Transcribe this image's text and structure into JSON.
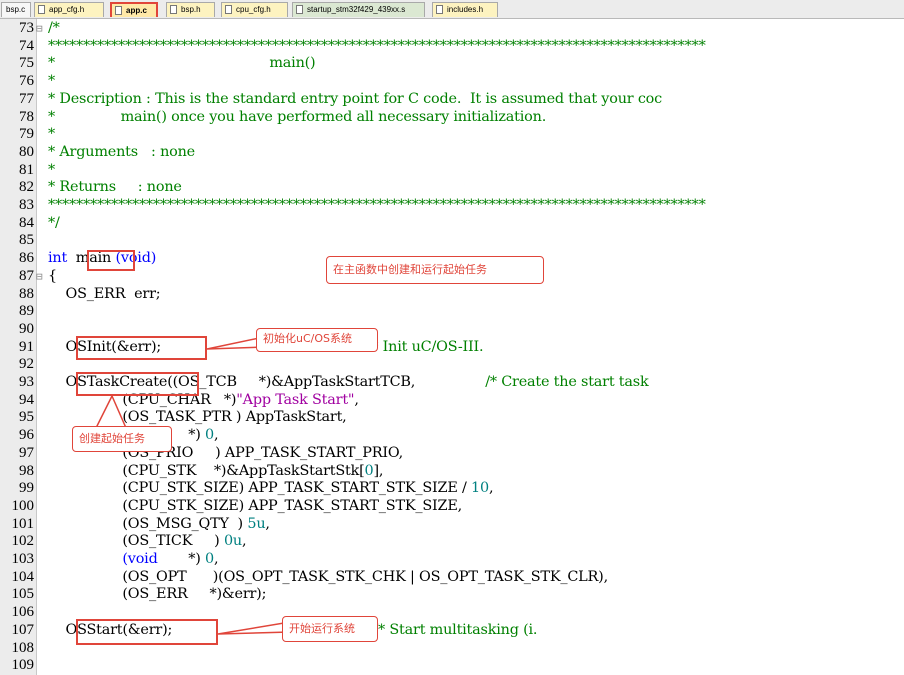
{
  "tabs": [
    {
      "label": "bsp.c",
      "kind": "c",
      "icon": "c-file-icon"
    },
    {
      "label": "app_cfg.h",
      "kind": "h",
      "icon": "h-file-icon"
    },
    {
      "label": "app.c",
      "kind": "c",
      "icon": "c-file-icon",
      "active": true
    },
    {
      "label": "bsp.h",
      "kind": "h",
      "icon": "h-file-icon"
    },
    {
      "label": "cpu_cfg.h",
      "kind": "h",
      "icon": "h-file-icon"
    },
    {
      "label": "startup_stm32f429_439xx.s",
      "kind": "s",
      "icon": "asm-file-icon"
    },
    {
      "label": "includes.h",
      "kind": "h",
      "icon": "h-file-icon"
    }
  ],
  "lines": [
    {
      "n": "73",
      "fold": "⊟",
      "parts": [
        [
          "cm",
          "/*"
        ]
      ]
    },
    {
      "n": "74",
      "parts": [
        [
          "cm",
          "**********************************************************************************************"
        ]
      ]
    },
    {
      "n": "75",
      "parts": [
        [
          "cm",
          "*                                                 main()"
        ]
      ]
    },
    {
      "n": "76",
      "parts": [
        [
          "cm",
          "*"
        ]
      ]
    },
    {
      "n": "77",
      "parts": [
        [
          "cm",
          "* Description : This is the standard entry point for C code.  It is assumed that your coc"
        ]
      ]
    },
    {
      "n": "78",
      "parts": [
        [
          "cm",
          "*               main() once you have performed all necessary initialization."
        ]
      ]
    },
    {
      "n": "79",
      "parts": [
        [
          "cm",
          "*"
        ]
      ]
    },
    {
      "n": "80",
      "parts": [
        [
          "cm",
          "* Arguments   : none"
        ]
      ]
    },
    {
      "n": "81",
      "parts": [
        [
          "cm",
          "*"
        ]
      ]
    },
    {
      "n": "82",
      "parts": [
        [
          "cm",
          "* Returns     : none"
        ]
      ]
    },
    {
      "n": "83",
      "parts": [
        [
          "cm",
          "**********************************************************************************************"
        ]
      ]
    },
    {
      "n": "84",
      "parts": [
        [
          "cm",
          "*/"
        ]
      ]
    },
    {
      "n": "85",
      "parts": []
    },
    {
      "n": "86",
      "parts": [
        [
          "kw",
          "int"
        ],
        [
          "",
          "  main "
        ],
        [
          "kw",
          "(void)"
        ]
      ]
    },
    {
      "n": "87",
      "fold": "⊟",
      "parts": [
        [
          "",
          "{"
        ]
      ]
    },
    {
      "n": "88",
      "parts": [
        [
          "",
          "    OS_ERR  err;"
        ]
      ]
    },
    {
      "n": "89",
      "parts": []
    },
    {
      "n": "90",
      "parts": []
    },
    {
      "n": "91",
      "parts": [
        [
          "",
          "    OSInit(&err);                                               "
        ],
        [
          "cm",
          "/* Init uC/OS-III."
        ]
      ]
    },
    {
      "n": "92",
      "parts": []
    },
    {
      "n": "93",
      "parts": [
        [
          "",
          "    OSTaskCreate((OS_TCB     *)&AppTaskStartTCB,                "
        ],
        [
          "cm",
          "/* Create the start task"
        ]
      ]
    },
    {
      "n": "94",
      "parts": [
        [
          "",
          "                 (CPU_CHAR   *)"
        ],
        [
          "str",
          "\"App Task Start\""
        ],
        [
          "",
          ","
        ]
      ]
    },
    {
      "n": "95",
      "parts": [
        [
          "",
          "                 (OS_TASK_PTR ) AppTaskStart,"
        ]
      ]
    },
    {
      "n": "96",
      "parts": [
        [
          "",
          "                 "
        ],
        [
          "kw",
          "(void"
        ],
        [
          "",
          "       *) "
        ],
        [
          "num",
          "0"
        ],
        [
          "",
          ","
        ]
      ]
    },
    {
      "n": "97",
      "parts": [
        [
          "",
          "                 (OS_PRIO     ) APP_TASK_START_PRIO,"
        ]
      ]
    },
    {
      "n": "98",
      "parts": [
        [
          "",
          "                 (CPU_STK    *)&AppTaskStartStk["
        ],
        [
          "num",
          "0"
        ],
        [
          "",
          "],"
        ]
      ]
    },
    {
      "n": "99",
      "parts": [
        [
          "",
          "                 (CPU_STK_SIZE) APP_TASK_START_STK_SIZE / "
        ],
        [
          "num",
          "10"
        ],
        [
          "",
          ","
        ]
      ]
    },
    {
      "n": "100",
      "parts": [
        [
          "",
          "                 (CPU_STK_SIZE) APP_TASK_START_STK_SIZE,"
        ]
      ]
    },
    {
      "n": "101",
      "parts": [
        [
          "",
          "                 (OS_MSG_QTY  ) "
        ],
        [
          "num",
          "5u"
        ],
        [
          "",
          ","
        ]
      ]
    },
    {
      "n": "102",
      "parts": [
        [
          "",
          "                 (OS_TICK     ) "
        ],
        [
          "num",
          "0u"
        ],
        [
          "",
          ","
        ]
      ]
    },
    {
      "n": "103",
      "parts": [
        [
          "",
          "                 "
        ],
        [
          "kw",
          "(void"
        ],
        [
          "",
          "       *) "
        ],
        [
          "num",
          "0"
        ],
        [
          "",
          ","
        ]
      ]
    },
    {
      "n": "104",
      "parts": [
        [
          "",
          "                 (OS_OPT      )(OS_OPT_TASK_STK_CHK | OS_OPT_TASK_STK_CLR),"
        ]
      ]
    },
    {
      "n": "105",
      "parts": [
        [
          "",
          "                 (OS_ERR     *)&err);"
        ]
      ]
    },
    {
      "n": "106",
      "parts": []
    },
    {
      "n": "107",
      "parts": [
        [
          "",
          "    OSStart(&err);                                              "
        ],
        [
          "cm",
          "/* Start multitasking (i."
        ]
      ]
    },
    {
      "n": "108",
      "parts": []
    },
    {
      "n": "109",
      "parts": []
    }
  ],
  "annotations": {
    "main_note": "在主函数中创建和运行起始任务",
    "init_note": "初始化uC/OS系统",
    "create_note": "创建起始任务",
    "start_note": "开始运行系统"
  },
  "colors": {
    "comment": "#008000",
    "keyword": "#0000ff",
    "string": "#a000a0",
    "number": "#008080",
    "annotation": "#e0453a"
  }
}
